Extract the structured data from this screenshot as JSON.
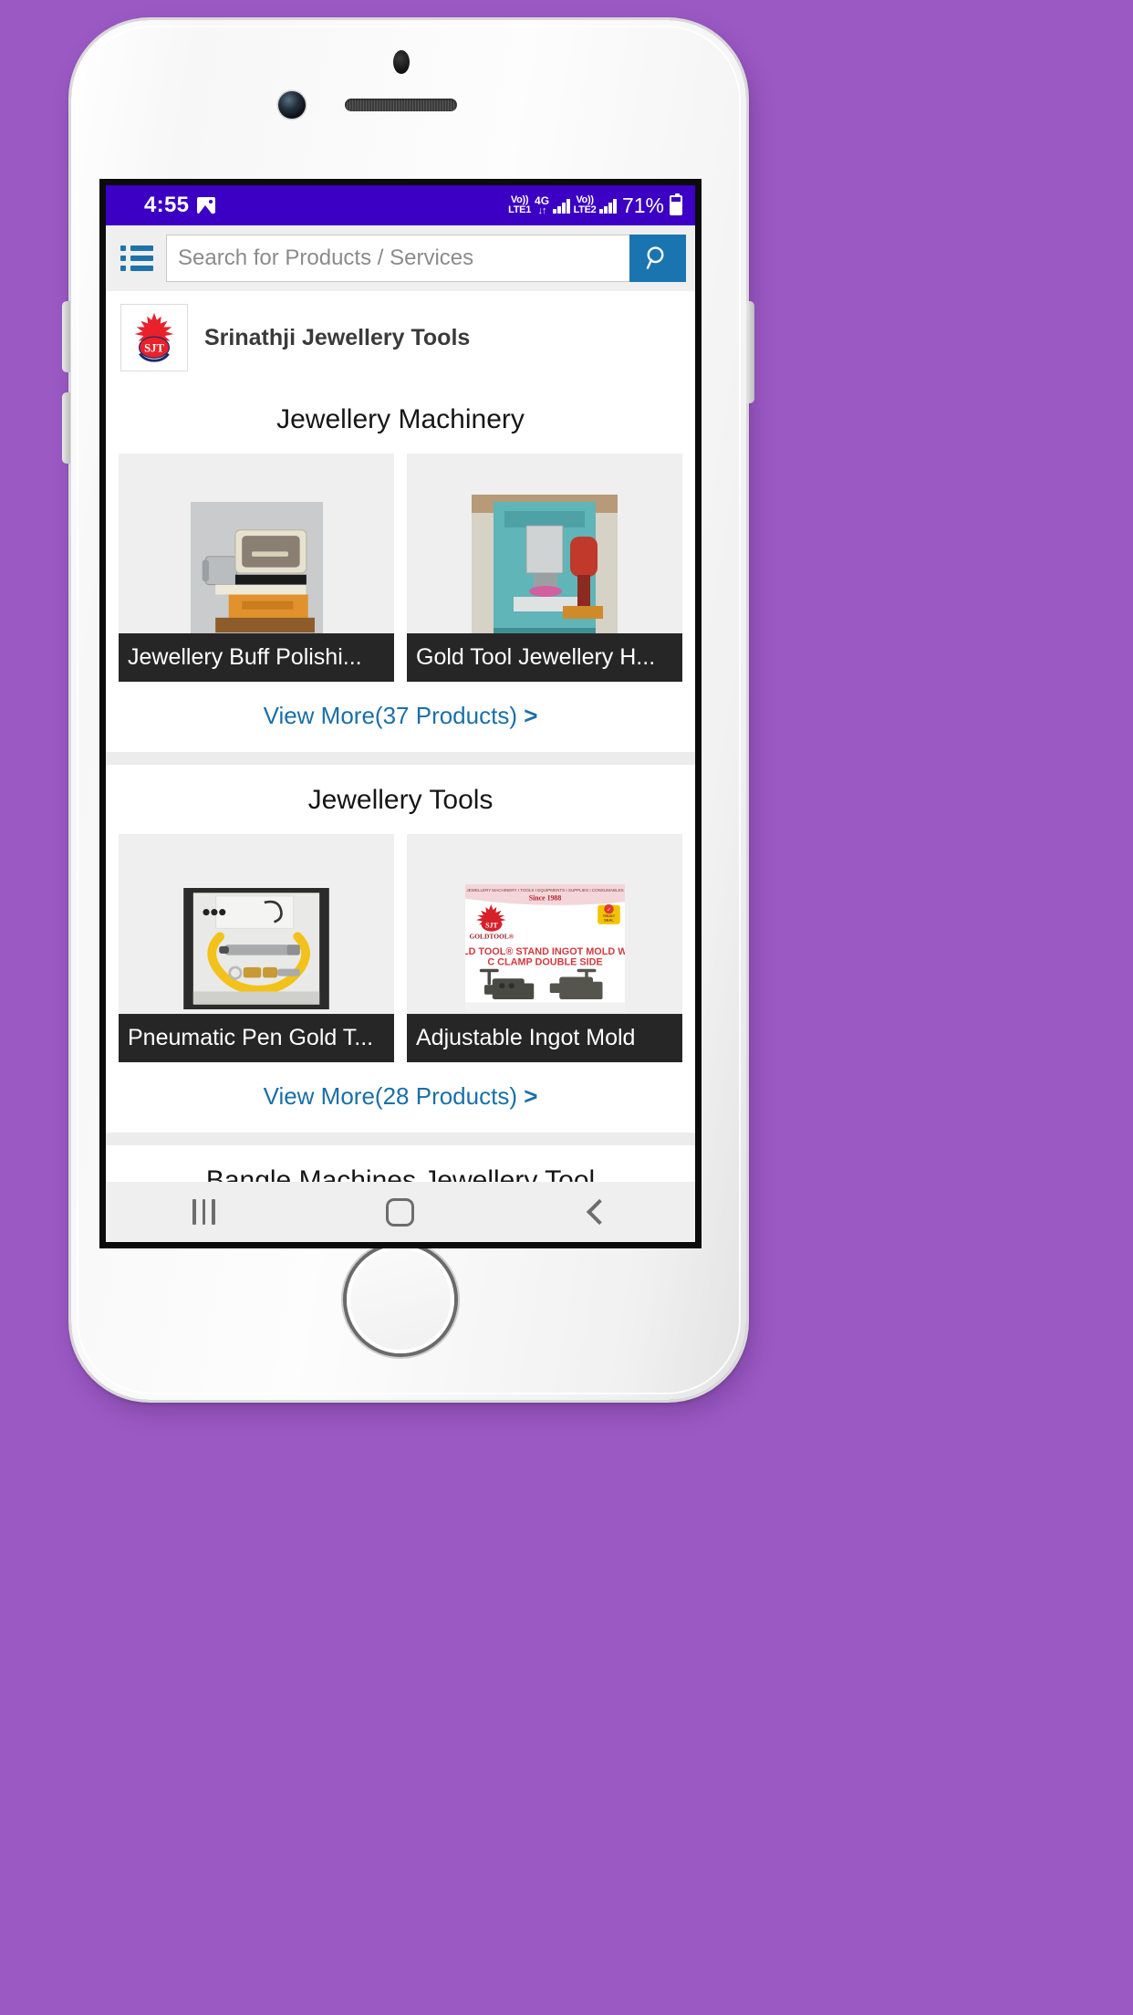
{
  "device": {
    "frame_color": "#f4f4f4",
    "background_color": "#9b59c4"
  },
  "status_bar": {
    "time": "4:55",
    "gallery_icon": "gallery-icon",
    "sim1_volte_top": "Vo))",
    "sim1_volte_bottom": "LTE1",
    "network_type": "4G",
    "data_arrows": "↓↑",
    "sim2_volte_top": "Vo))",
    "sim2_volte_bottom": "LTE2",
    "battery_percent": "71%",
    "battery_icon": "battery-icon",
    "background_color": "#3b00c4"
  },
  "header": {
    "menu_icon": "hamburger-menu-icon",
    "search_placeholder": "Search for Products / Services",
    "search_value": "",
    "search_icon": "search-icon",
    "search_button_color": "#1a74b0"
  },
  "supplier": {
    "logo_icon": "srinathji-crown-logo",
    "name": "Srinathji Jewellery Tools"
  },
  "sections": [
    {
      "title": "Jewellery Machinery",
      "products": [
        {
          "caption": "Jewellery Buff Polishi...",
          "image": "buffing-machine-photo"
        },
        {
          "caption": "Gold Tool Jewellery H...",
          "image": "hydraulic-press-photo"
        }
      ],
      "view_more_label": "View More(37 Products)",
      "view_more_chevron": ">"
    },
    {
      "title": "Jewellery Tools",
      "products": [
        {
          "caption": "Pneumatic Pen Gold T...",
          "image": "pneumatic-pen-photo"
        },
        {
          "caption": "Adjustable Ingot Mold",
          "image": "ingot-mold-banner",
          "banner": {
            "tagline": "JEWELLERY MACHINERY I TOOLS I EQUIPMENTS I SUPPLIES I CONSUMABLES",
            "since": "Since 1988",
            "brand": "GOLDTOOL®",
            "title_line1": "GOLD TOOL® STAND INGOT MOLD WITH",
            "title_line2": "C CLAMP DOUBLE SIDE",
            "seal_line1": "TRUST",
            "seal_line2": "SEAL"
          }
        }
      ],
      "view_more_label": "View More(28 Products)",
      "view_more_chevron": ">"
    },
    {
      "title": "Bangle Machines Jewellery Tool",
      "products": [
        {
          "caption": "",
          "image": ""
        },
        {
          "caption": "",
          "image": ""
        }
      ],
      "view_more_label": "",
      "view_more_chevron": ""
    }
  ],
  "android_nav": {
    "recents_icon": "recents-icon",
    "home_icon": "home-icon",
    "back_icon": "back-icon"
  }
}
